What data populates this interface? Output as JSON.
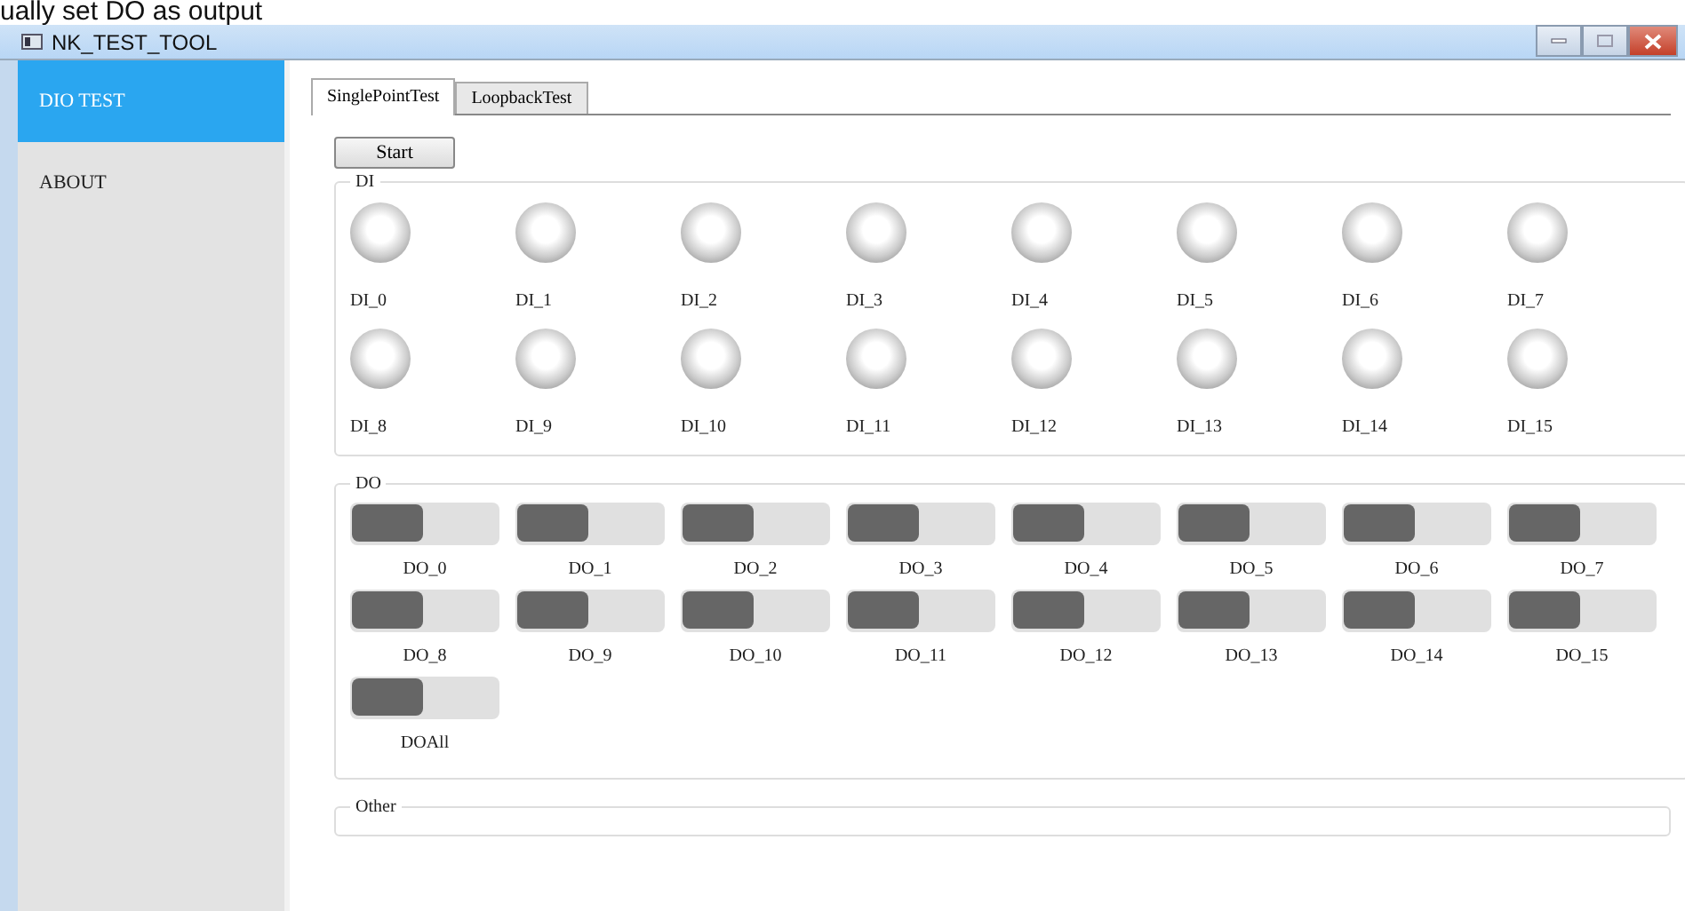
{
  "caption": "ually set DO as output",
  "window": {
    "title": "NK_TEST_TOOL"
  },
  "sidebar": {
    "items": [
      {
        "label": "DIO TEST",
        "selected": true
      },
      {
        "label": "ABOUT",
        "selected": false
      }
    ]
  },
  "tabs": [
    {
      "label": "SinglePointTest",
      "selected": true
    },
    {
      "label": "LoopbackTest",
      "selected": false
    }
  ],
  "start_button": "Start",
  "di": {
    "title": "DI",
    "inputs": [
      {
        "label": "DI_0",
        "lit": false
      },
      {
        "label": "DI_1",
        "lit": false
      },
      {
        "label": "DI_2",
        "lit": false
      },
      {
        "label": "DI_3",
        "lit": false
      },
      {
        "label": "DI_4",
        "lit": false
      },
      {
        "label": "DI_5",
        "lit": false
      },
      {
        "label": "DI_6",
        "lit": false
      },
      {
        "label": "DI_7",
        "lit": false
      },
      {
        "label": "DI_8",
        "lit": false
      },
      {
        "label": "DI_9",
        "lit": false
      },
      {
        "label": "DI_10",
        "lit": false
      },
      {
        "label": "DI_11",
        "lit": false
      },
      {
        "label": "DI_12",
        "lit": false
      },
      {
        "label": "DI_13",
        "lit": false
      },
      {
        "label": "DI_14",
        "lit": false
      },
      {
        "label": "DI_15",
        "lit": false
      }
    ]
  },
  "do": {
    "title": "DO",
    "outputs": [
      {
        "label": "DO_0",
        "on": false
      },
      {
        "label": "DO_1",
        "on": false
      },
      {
        "label": "DO_2",
        "on": false
      },
      {
        "label": "DO_3",
        "on": false
      },
      {
        "label": "DO_4",
        "on": false
      },
      {
        "label": "DO_5",
        "on": false
      },
      {
        "label": "DO_6",
        "on": false
      },
      {
        "label": "DO_7",
        "on": false
      },
      {
        "label": "DO_8",
        "on": false
      },
      {
        "label": "DO_9",
        "on": false
      },
      {
        "label": "DO_10",
        "on": false
      },
      {
        "label": "DO_11",
        "on": false
      },
      {
        "label": "DO_12",
        "on": false
      },
      {
        "label": "DO_13",
        "on": false
      },
      {
        "label": "DO_14",
        "on": false
      },
      {
        "label": "DO_15",
        "on": false
      },
      {
        "label": "DOAll",
        "on": false
      }
    ]
  },
  "other": {
    "title": "Other"
  }
}
